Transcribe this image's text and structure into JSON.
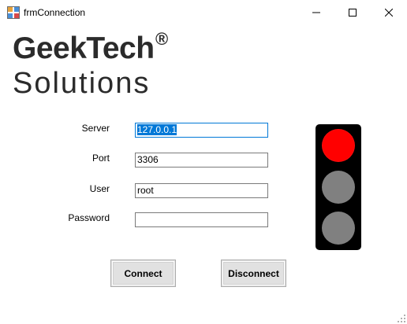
{
  "window": {
    "title": "frmConnection",
    "minimize_label": "Minimize",
    "maximize_label": "Maximize",
    "close_label": "Close"
  },
  "logo": {
    "line1": "GeekTech",
    "registered": "®",
    "line2": "Solutions"
  },
  "form": {
    "server": {
      "label": "Server",
      "value": "127.0.0.1"
    },
    "port": {
      "label": "Port",
      "value": "3306"
    },
    "user": {
      "label": "User",
      "value": "root"
    },
    "password": {
      "label": "Password",
      "value": ""
    }
  },
  "buttons": {
    "connect": "Connect",
    "disconnect": "Disconnect"
  },
  "traffic_light": {
    "red": {
      "color": "#ff0000",
      "lit": true
    },
    "yellow": {
      "color": "#808080",
      "lit": false
    },
    "green": {
      "color": "#808080",
      "lit": false
    }
  }
}
